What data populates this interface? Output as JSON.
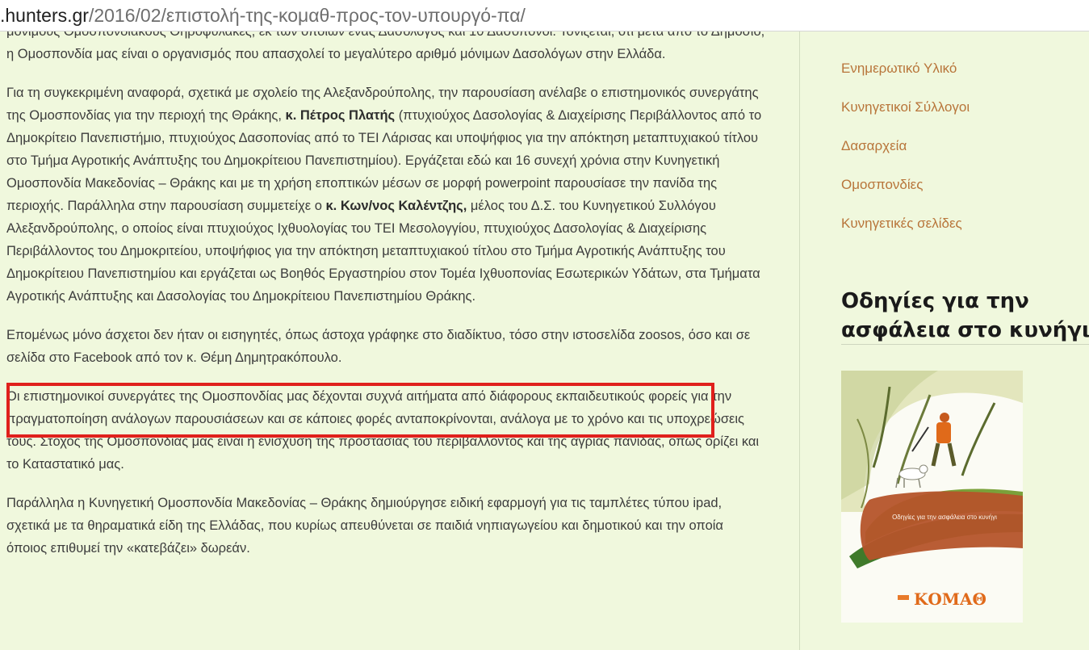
{
  "address_bar": {
    "domain": ".hunters.gr",
    "path": "/2016/02/επιστολή-της-κομαθ-προς-τον-υπουργό-πα/"
  },
  "article": {
    "p1": "μόνιμους Ομοσπονδιακούς Θηροφύλακες, εκ των οποίων ένας Δασολόγος και 10 Δασοπόνοι. Τονίζεται, ότι μετά από το Δημόσιο, η Ομοσπονδία μας είναι ο οργανισμός που απασχολεί το μεγαλύτερο αριθμό μόνιμων Δασολόγων στην Ελλάδα.",
    "p2_a": "Για τη συγκεκριμένη αναφορά, σχετικά με σχολείο της Αλεξανδρούπολης, την παρουσίαση ανέλαβε ο επιστημονικός συνεργάτης της Ομοσπονδίας για την περιοχή της Θράκης, ",
    "p2_name1": "κ. Πέτρος Πλατής",
    "p2_b": " (πτυχιούχος Δασολογίας & Διαχείρισης Περιβάλλοντος από το Δημοκρίτειο Πανεπιστήμιο, πτυχιούχος Δασοπονίας από το ΤΕΙ Λάρισας και υποψήφιος για την απόκτηση μεταπτυχιακού τίτλου στο Τμήμα Αγροτικής Ανάπτυξης του Δημοκρίτειου Πανεπιστημίου). Εργάζεται εδώ και 16 συνεχή χρόνια στην Κυνηγετική Ομοσπονδία Μακεδονίας – Θράκης και με τη χρήση εποπτικών μέσων σε μορφή powerpoint παρουσίασε την πανίδα της περιοχής. Παράλληλα στην παρουσίαση συμμετείχε ο ",
    "p2_name2": "κ. Κων/νος Καλέντζης,",
    "p2_c": " μέλος του Δ.Σ. του Κυνηγετικού Συλλόγου Αλεξανδρούπολης, ο οποίος είναι πτυχιούχος Ιχθυολογίας του ΤΕΙ Μεσολογγίου, πτυχιούχος Δασολογίας & Διαχείρισης Περιβάλλοντος του Δημοκριτείου, υποψήφιος για την απόκτηση μεταπτυχιακού τίτλου στο Τμήμα Αγροτικής Ανάπτυξης του Δημοκρίτειου Πανεπιστημίου και εργάζεται ως Βοηθός Εργαστηρίου στον Τομέα Ιχθυοπονίας Εσωτερικών Υδάτων, στα Τμήματα Αγροτικής Ανάπτυξης και Δασολογίας του Δημοκρίτειου Πανεπιστημίου Θράκης.",
    "p3": "Επομένως μόνο άσχετοι δεν ήταν οι εισηγητές, όπως άστοχα γράφηκε στο διαδίκτυο, τόσο στην ιστοσελίδα zoosos, όσο και σε σελίδα στο Facebook από τον κ. Θέμη Δημητρακόπουλο.",
    "p4": "Οι επιστημονικοί συνεργάτες της Ομοσπονδίας μας δέχονται συχνά αιτήματα από διάφορους εκπαιδευτικούς φορείς για την πραγματοποίηση ανάλογων παρουσιάσεων και σε κάποιες φορές ανταποκρίνονται, ανάλογα με το χρόνο και τις υποχρεώσεις τους. Στόχος της Ομοσπονδίας μας είναι η ενίσχυση της προστασίας του περιβάλλοντος και της άγριας πανίδας, όπως ορίζει και το Καταστατικό μας.",
    "p5": "Παράλληλα η Κυνηγετική Ομοσπονδία Μακεδονίας – Θράκης δημιούργησε ειδική εφαρμογή για τις ταμπλέτες τύπου ipad, σχετικά με τα θηραματικά είδη της Ελλάδας, που κυρίως απευθύνεται σε παιδιά νηπιαγωγείου και δημοτικού και την οποία όποιος επιθυμεί την «κατεβάζει» δωρεάν."
  },
  "highlight_color": "#e0201c",
  "sidebar": {
    "links": [
      "Ενημερωτικό Υλικό",
      "Κυνηγετικοί Σύλλογοι",
      "Δασαρχεία",
      "Ομοσπονδίες",
      "Κυνηγετικές σελίδες"
    ],
    "link_color": "#b8753a",
    "widget_title_line1": "Οδηγίες για την",
    "widget_title_line2": "ασφάλεια στο κυνήγι",
    "booklet": {
      "cover_title": "Οδηγίες για την ασφάλεια στο κυνήγι",
      "logo_text": "ΚΟΜΑΘ"
    }
  }
}
